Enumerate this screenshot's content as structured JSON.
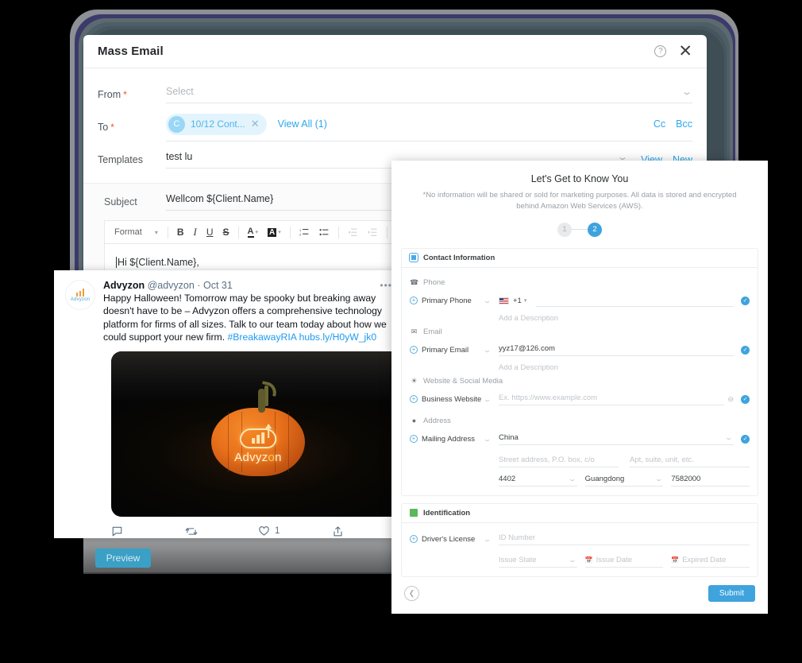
{
  "mass_email": {
    "title": "Mass Email",
    "help_icon": "help-circle-icon",
    "close_icon": "close-icon",
    "from": {
      "label": "From",
      "required": "*",
      "placeholder": "Select",
      "value": ""
    },
    "to": {
      "label": "To",
      "required": "*",
      "chip_avatar": "C",
      "chip_text": "10/12 Cont...",
      "chip_remove_icon": "close-icon",
      "view_all": "View All (1)",
      "cc": "Cc",
      "bcc": "Bcc"
    },
    "templates": {
      "label": "Templates",
      "value": "test lu",
      "view": "View",
      "new": "New"
    },
    "subject": {
      "label": "Subject",
      "value": "Wellcom ${Client.Name}"
    },
    "toolbar": {
      "format": "Format",
      "bold": "B",
      "italic": "I",
      "underline": "U",
      "strike": "S",
      "text_color": "A",
      "highlight": "A",
      "ordered_list": "ordered-list-icon",
      "bullet_list": "bullet-list-icon",
      "outdent": "outdent-icon",
      "indent": "indent-icon",
      "link": "link-icon"
    },
    "editor_body": "Hi ${Client.Name},",
    "preview_button": "Preview"
  },
  "tweet": {
    "avatar_name": "Advyzon",
    "display_name": "Advyzon",
    "handle": "@advyzon",
    "separator": "·",
    "date": "Oct 31",
    "more_icon": "more-horizontal-icon",
    "text": "Happy Halloween! Tomorrow may be spooky but breaking away doesn't have to be – Advyzon offers a comprehensive technology platform for firms of all sizes. Talk to our team today about how we could support your new firm. ",
    "hashtag": "#BreakawayRIA",
    "link": "hubs.ly/H0yW_jk0",
    "image_alt": "Carved pumpkin with Advyzon logo",
    "image_logo_word_a": "Advyz",
    "image_logo_word_b": "o",
    "image_logo_word_c": "n",
    "actions": {
      "reply_icon": "reply-icon",
      "reply_count": "",
      "retweet_icon": "retweet-icon",
      "retweet_count": "",
      "like_icon": "heart-icon",
      "like_count": "1",
      "share_icon": "share-icon"
    }
  },
  "know_you": {
    "title": "Let's Get to Know You",
    "subtitle": "*No information will be shared or sold for marketing purposes. All data is stored and encrypted behind Amazon Web Services (AWS).",
    "steps": [
      {
        "label": "1",
        "active": false
      },
      {
        "label": "2",
        "active": true
      }
    ],
    "contact_card": {
      "icon": "contact-card-icon",
      "title": "Contact Information",
      "groups": [
        {
          "icon": "phone-icon",
          "title": "Phone",
          "field_label": "Primary Phone",
          "country_flag": "us-flag-icon",
          "country_code": "+1",
          "value": "",
          "description_placeholder": "Add a Description"
        },
        {
          "icon": "mail-icon",
          "title": "Email",
          "field_label": "Primary Email",
          "value": "yyz17@126.com",
          "description_placeholder": "Add a Description"
        },
        {
          "icon": "globe-icon",
          "title": "Website & Social Media",
          "field_label": "Business Website",
          "placeholder": "Ex. https://www.example.com"
        },
        {
          "icon": "location-pin-icon",
          "title": "Address",
          "field_label": "Mailing Address",
          "country": "China",
          "street_placeholder": "Street address, P.O. box, c/o",
          "apt_placeholder": "Apt, suite, unit, etc.",
          "city_code": "4402",
          "province": "Guangdong",
          "postal": "7582000"
        }
      ]
    },
    "identification_card": {
      "icon": "identification-icon",
      "title": "Identification",
      "field_label": "Driver's License",
      "id_placeholder": "ID Number",
      "issue_state_placeholder": "Issue State",
      "issue_date_placeholder": "Issue Date",
      "expired_date_placeholder": "Expired Date"
    },
    "back_icon": "chevron-left-icon",
    "submit_button": "Submit"
  },
  "colors": {
    "accent_blue": "#3fa3dd",
    "link_blue": "#2ba7ef",
    "required_red": "#f4511e",
    "preview_button": "#3aa0c6",
    "pumpkin_orange": "#e8701b"
  }
}
